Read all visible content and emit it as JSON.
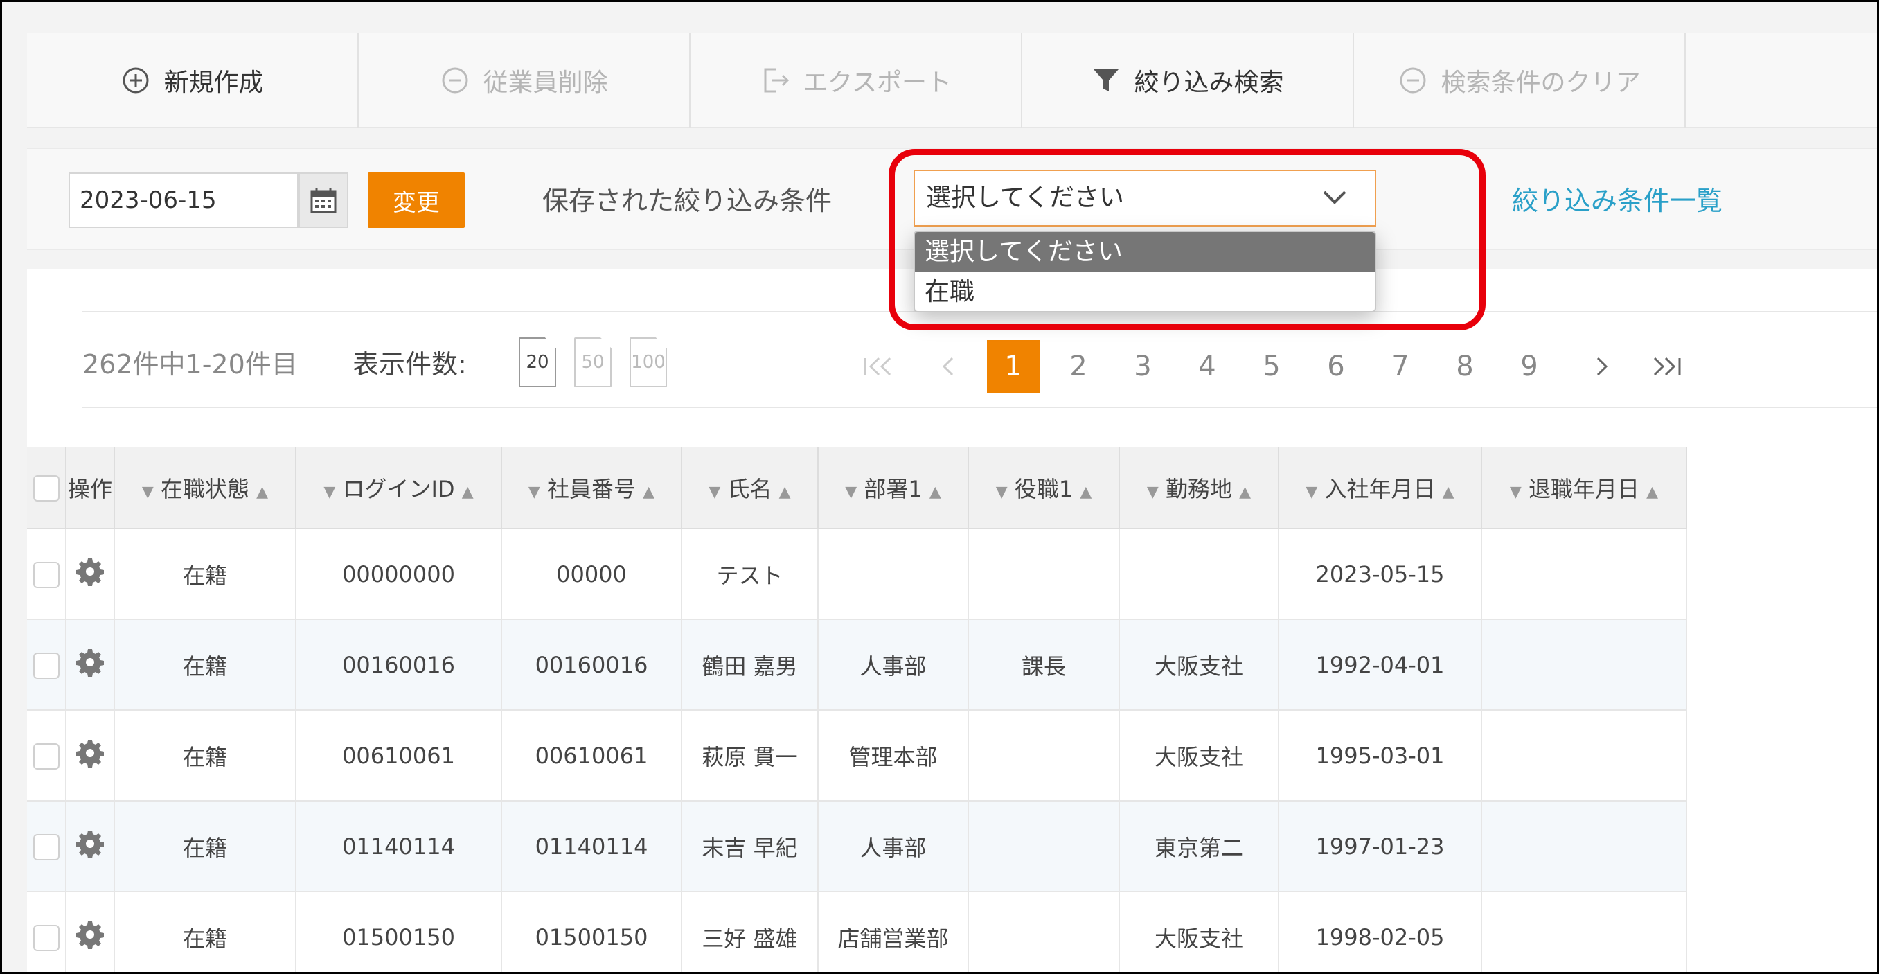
{
  "toolbar": {
    "new": "新規作成",
    "delete": "従業員削除",
    "export": "エクスポート",
    "filter": "絞り込み検索",
    "clear": "検索条件のクリア"
  },
  "filterbar": {
    "date": "2023-06-15",
    "change_button": "変更",
    "saved_label": "保存された絞り込み条件",
    "select_value": "選択してください",
    "options": [
      "選択してください",
      "在職"
    ],
    "list_link": "絞り込み条件一覧"
  },
  "pagination": {
    "count_text": "262件中1-20件目",
    "page_size_label": "表示件数:",
    "page_sizes": [
      "20",
      "50",
      "100"
    ],
    "first": "|«",
    "prev": "‹",
    "pages": [
      "1",
      "2",
      "3",
      "4",
      "5",
      "6",
      "7",
      "8",
      "9"
    ],
    "next": "›",
    "last": "»|"
  },
  "table": {
    "headers": [
      "操作",
      "在職状態",
      "ログインID",
      "社員番号",
      "氏名",
      "部署1",
      "役職1",
      "勤務地",
      "入社年月日",
      "退職年月日"
    ],
    "rows": [
      [
        "在籍",
        "00000000",
        "00000",
        "テスト",
        "",
        "",
        "",
        "2023-05-15",
        ""
      ],
      [
        "在籍",
        "00160016",
        "00160016",
        "鶴田 嘉男",
        "人事部",
        "課長",
        "大阪支社",
        "1992-04-01",
        ""
      ],
      [
        "在籍",
        "00610061",
        "00610061",
        "萩原 貫一",
        "管理本部",
        "",
        "大阪支社",
        "1995-03-01",
        ""
      ],
      [
        "在籍",
        "01140114",
        "01140114",
        "末吉 早紀",
        "人事部",
        "",
        "東京第二",
        "1997-01-23",
        ""
      ],
      [
        "在籍",
        "01500150",
        "01500150",
        "三好 盛雄",
        "店舗営業部",
        "",
        "大阪支社",
        "1998-02-05",
        ""
      ]
    ]
  },
  "colors": {
    "accent": "#f08300",
    "highlight": "#e8000b",
    "link": "#2aa0c8"
  }
}
